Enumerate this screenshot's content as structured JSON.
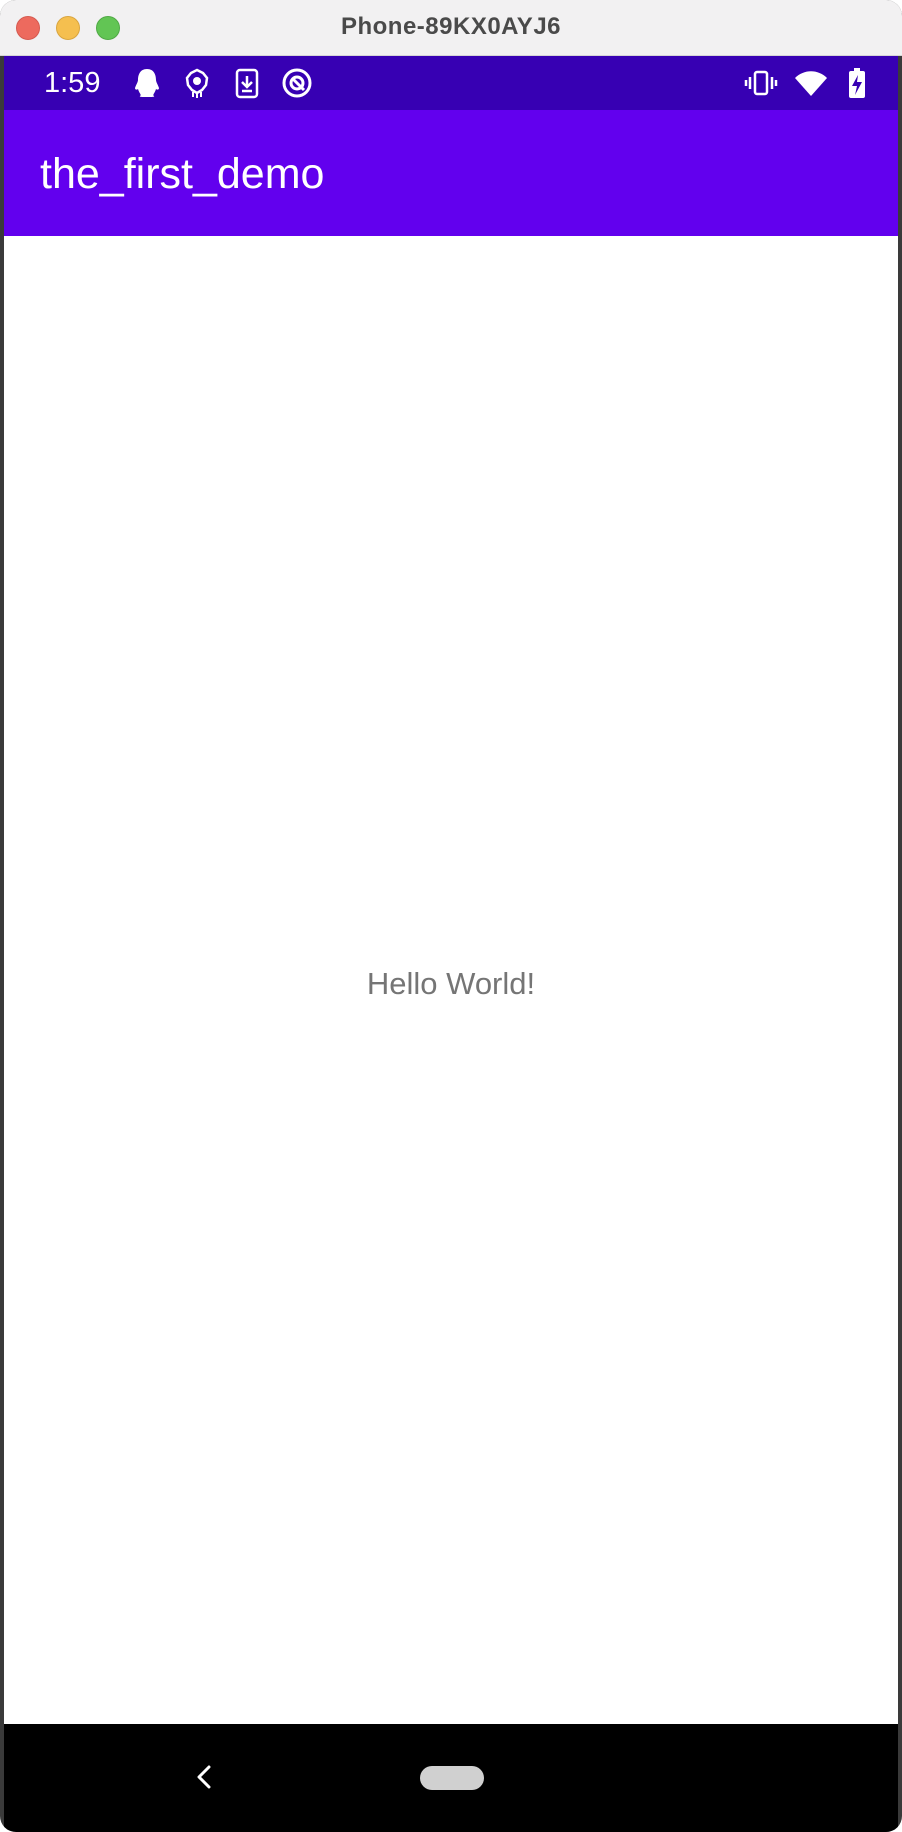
{
  "window": {
    "title": "Phone-89KX0AYJ6"
  },
  "status_bar": {
    "time": "1:59",
    "left_icons": [
      "qq-penguin-icon",
      "shield-badge-icon",
      "download-icon",
      "sync-circle-icon"
    ],
    "right_icons": [
      "vibrate-icon",
      "wifi-icon",
      "battery-charging-icon"
    ]
  },
  "app_bar": {
    "title": "the_first_demo"
  },
  "main": {
    "text": "Hello World!"
  },
  "nav_bar": {
    "buttons": [
      "back-icon",
      "home-pill-icon"
    ]
  },
  "colors": {
    "status_bar": "#3700b3",
    "app_bar": "#6200ee",
    "body_text": "#757575",
    "nav_bar": "#000000"
  }
}
